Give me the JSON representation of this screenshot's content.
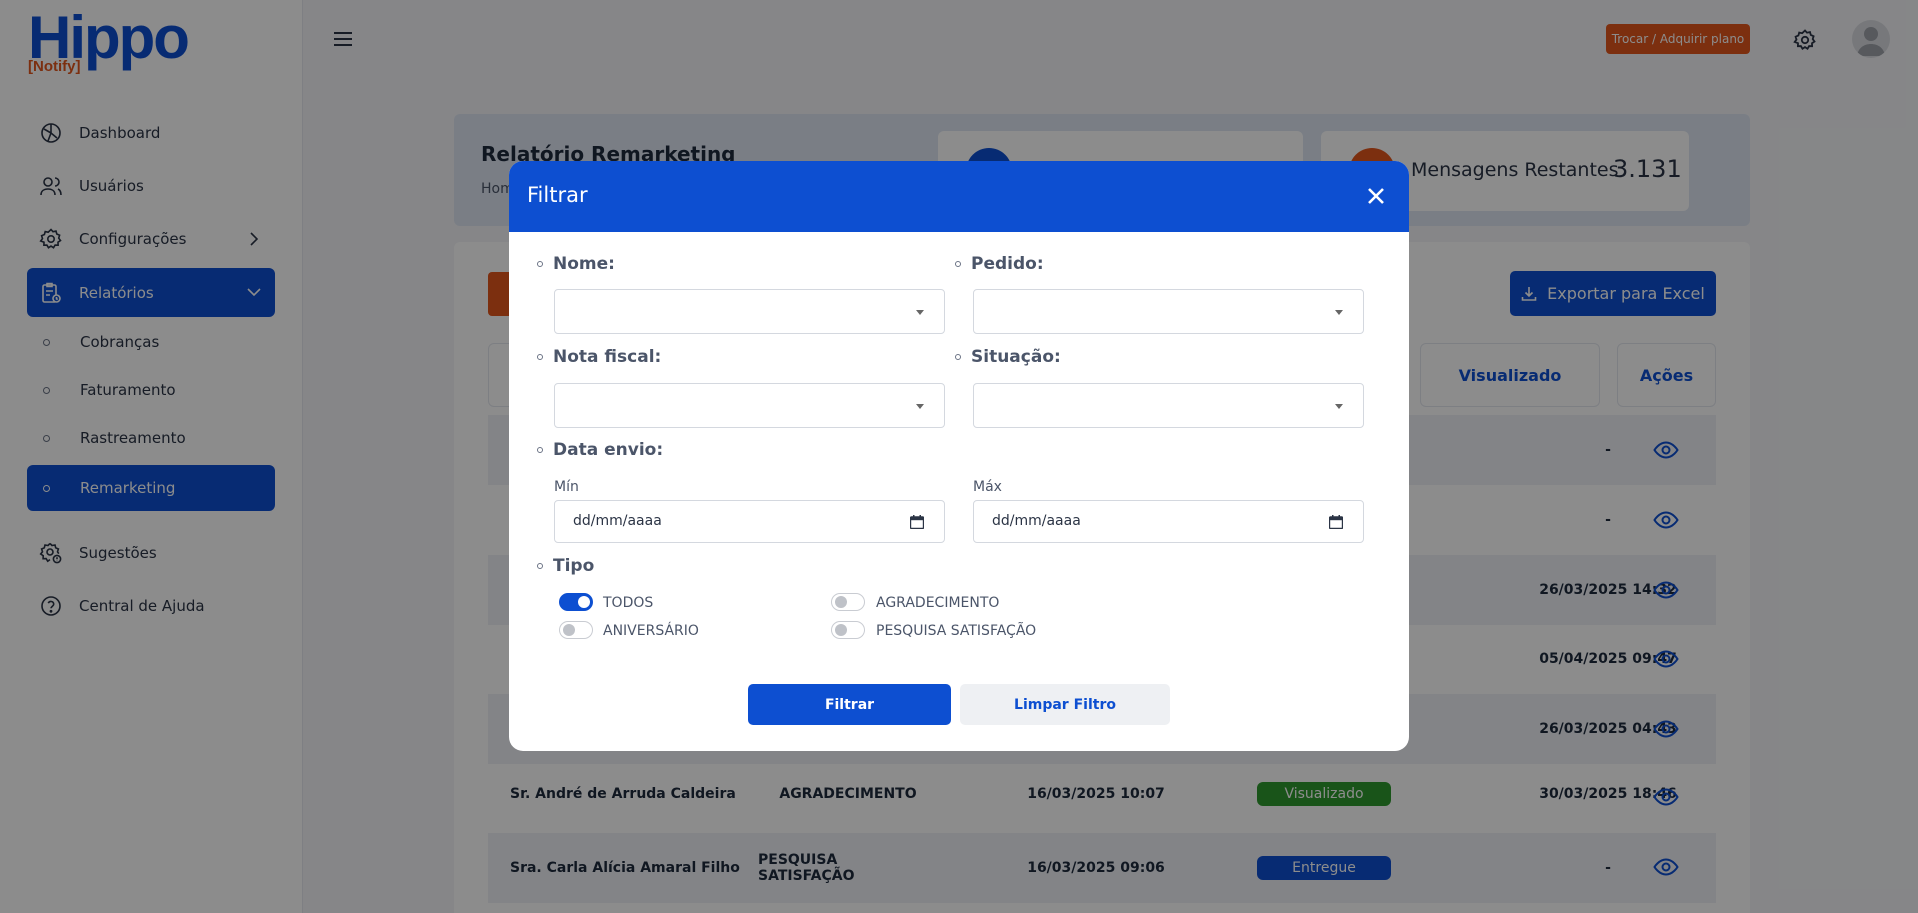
{
  "brand": {
    "name": "Hippo",
    "sub": "[Notify]"
  },
  "sidebar": {
    "items": [
      {
        "label": "Dashboard",
        "icon": "dashboard-icon"
      },
      {
        "label": "Usuários",
        "icon": "users-icon"
      },
      {
        "label": "Configurações",
        "icon": "gear-icon"
      },
      {
        "label": "Relatórios",
        "icon": "report-icon"
      }
    ],
    "subitems": [
      {
        "label": "Cobranças"
      },
      {
        "label": "Faturamento"
      },
      {
        "label": "Rastreamento"
      },
      {
        "label": "Remarketing"
      }
    ],
    "bottom": [
      {
        "label": "Sugestões",
        "icon": "suggestion-gear-icon"
      },
      {
        "label": "Central de Ajuda",
        "icon": "help-icon"
      }
    ]
  },
  "topbar": {
    "plan_button": "Trocar / Adquirir plano"
  },
  "page": {
    "title": "Relatório Remarketing",
    "breadcrumb": "Hom",
    "stats": [
      {
        "label": "",
        "value": ""
      },
      {
        "label": "Mensagens Restantes",
        "value": "3.131"
      }
    ],
    "export_button": "Exportar para Excel"
  },
  "table": {
    "headers_visible": [
      "Visualizado",
      "Ações"
    ],
    "rows": [
      {
        "name": "",
        "type": "",
        "sent": "",
        "status": "",
        "viewed": "-"
      },
      {
        "name": "",
        "type": "",
        "sent": "",
        "status": "",
        "viewed": "-"
      },
      {
        "name": "",
        "type": "",
        "sent": "",
        "status": "",
        "viewed": "26/03/2025 14:32"
      },
      {
        "name": "",
        "type": "",
        "sent": "",
        "status": "",
        "viewed": "05/04/2025 09:47"
      },
      {
        "name": "",
        "type": "",
        "sent": "",
        "status": "",
        "viewed": "26/03/2025 04:43"
      },
      {
        "name": "Sr. André de Arruda Caldeira",
        "type": "AGRADECIMENTO",
        "sent": "16/03/2025 10:07",
        "status": "Visualizado",
        "viewed": "30/03/2025 18:46"
      },
      {
        "name": "Sra. Carla Alícia Amaral Filho",
        "type": "PESQUISA SATISFAÇÃO",
        "sent": "16/03/2025 09:06",
        "status": "Entregue",
        "viewed": "-"
      }
    ],
    "status_colors": {
      "Visualizado": "#2e9a2e",
      "Entregue": "#0d4fd1"
    }
  },
  "modal": {
    "title": "Filtrar",
    "fields": {
      "nome": "Nome:",
      "pedido": "Pedido:",
      "nota": "Nota fiscal:",
      "situacao": "Situação:",
      "data": "Data envio:",
      "min": "Mín",
      "max": "Máx",
      "date_placeholder": "dd/mm/aaaa",
      "tipo": "Tipo"
    },
    "toggles": [
      {
        "label": "TODOS",
        "on": true
      },
      {
        "label": "AGRADECIMENTO",
        "on": false
      },
      {
        "label": "ANIVERSÁRIO",
        "on": false
      },
      {
        "label": "PESQUISA SATISFAÇÃO",
        "on": false
      }
    ],
    "filter_button": "Filtrar",
    "clear_button": "Limpar Filtro"
  },
  "colors": {
    "primary": "#0d4fd1",
    "accent": "#e2561c"
  }
}
